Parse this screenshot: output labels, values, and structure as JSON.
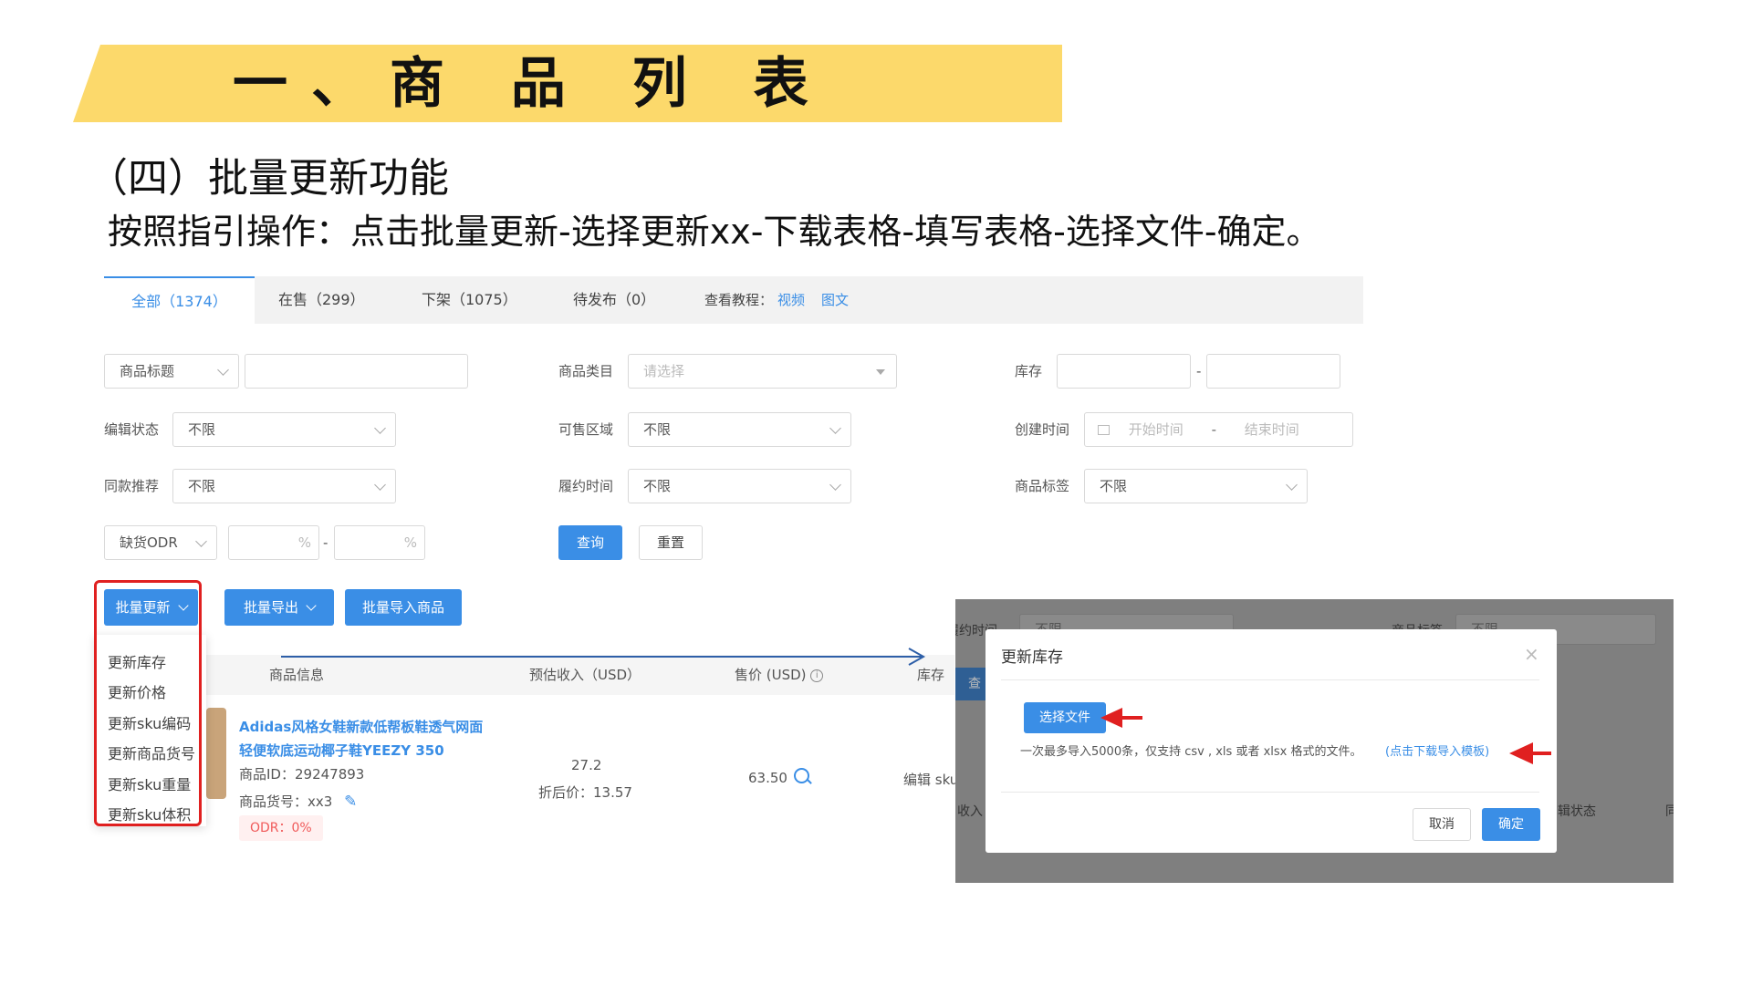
{
  "slide": {
    "title": "一、商 品 列 表",
    "section": "（四）批量更新功能",
    "instruction": "按照指引操作：点击批量更新-选择更新xx-下载表格-填写表格-选择文件-确定。"
  },
  "tabs": {
    "all": "全部（1374）",
    "on_sale": "在售（299）",
    "off_shelf": "下架（1075）",
    "pending": "待发布（0）",
    "tutorial_label": "查看教程：",
    "video": "视频",
    "article": "图文"
  },
  "filters": {
    "product_title_select": "商品标题",
    "category_label": "商品类目",
    "category_placeholder": "请选择",
    "stock_label": "库存",
    "range_dash": "-",
    "edit_status_label": "编辑状态",
    "edit_status_value": "不限",
    "sale_region_label": "可售区域",
    "sale_region_value": "不限",
    "create_time_label": "创建时间",
    "start_time_placeholder": "开始时间",
    "end_time_placeholder": "结束时间",
    "same_rec_label": "同款推荐",
    "same_rec_value": "不限",
    "fulfill_time_label": "履约时间",
    "fulfill_time_value": "不限",
    "product_tag_label": "商品标签",
    "product_tag_value": "不限",
    "odr_select": "缺货ODR",
    "percent": "%",
    "query_button": "查询",
    "reset_button": "重置"
  },
  "actions": {
    "batch_update": "批量更新",
    "batch_export": "批量导出",
    "batch_import": "批量导入商品"
  },
  "batch_menu": [
    "更新库存",
    "更新价格",
    "更新sku编码",
    "更新商品货号",
    "更新sku重量",
    "更新sku体积"
  ],
  "table": {
    "col_product_info": "商品信息",
    "col_est_income": "预估收入（USD）",
    "col_price": "售价 (USD)",
    "col_stock": "库存",
    "row": {
      "name_line1": "Adidas风格女鞋新款低帮板鞋透气网面",
      "name_line2": "轻便软底运动椰子鞋YEEZY 350",
      "product_id_label": "商品ID：",
      "product_id": "29247893",
      "sku_no_label": "商品货号：",
      "sku_no": "xx3",
      "odr": "ODR：0%",
      "est_income": "27.2",
      "discount_label": "折后价：",
      "discount_price": "13.57",
      "price": "63.50",
      "edit_sku": "编辑 sku"
    }
  },
  "dialog": {
    "bg_fulfill_label": "履约时间",
    "bg_unlimited": "不限",
    "bg_tag_label": "商品标签",
    "bg_income": "收入",
    "bg_edit_status": "辑状态",
    "bg_same": "同",
    "bg_query": "查",
    "title": "更新库存",
    "choose_file": "选择文件",
    "hint": "一次最多导入5000条，仅支持 csv , xls 或者 xlsx 格式的文件。",
    "template_link": "(点击下载导入模板)",
    "cancel": "取消",
    "confirm": "确定"
  },
  "colors": {
    "banner": "#fcd96b",
    "primary": "#3a8ee6",
    "highlight_red": "#e02020"
  }
}
